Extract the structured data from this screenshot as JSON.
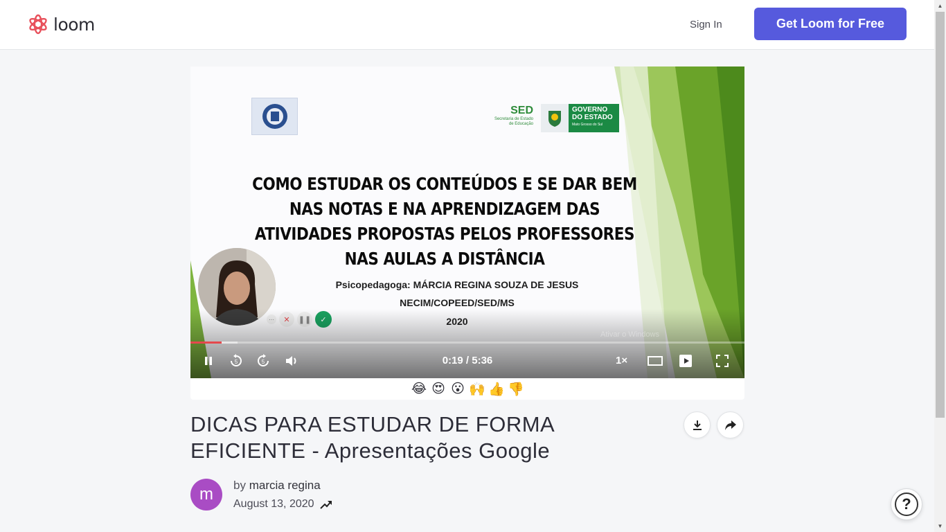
{
  "header": {
    "logo_text": "loom",
    "sign_in": "Sign In",
    "cta": "Get Loom for Free"
  },
  "slide": {
    "sed_label": "SED",
    "sed_sub": "Secretaria de Estado de Educação",
    "gov_label": "GOVERNO DO ESTADO",
    "gov_sub": "Mato Grosso do Sul",
    "title": "COMO ESTUDAR OS CONTEÚDOS E SE DAR BEM NAS NOTAS E NA APRENDIZAGEM DAS ATIVIDADES PROPOSTAS PELOS PROFESSORES NAS AULAS A DISTÂNCIA",
    "presenter": "Psicopedagoga: MÁRCIA REGINA SOUZA DE JESUS",
    "org": "NECIM/COPEED/SED/MS",
    "year": "2020",
    "watermark": "Ativar o Windows"
  },
  "player": {
    "time": "0:19 / 5:36",
    "speed": "1×",
    "progress": 0.056,
    "buffered": 0.085,
    "progress_color": "#e5484d"
  },
  "reactions": [
    "😂",
    "😍",
    "😮",
    "🙌",
    "👍",
    "👎"
  ],
  "video": {
    "title": "DICAS PARA ESTUDAR DE FORMA EFICIENTE - Apresentações Google",
    "by": "by",
    "owner": "marcia regina",
    "owner_initial": "m",
    "date": "August 13, 2020"
  },
  "help": {
    "label": "?"
  },
  "colors": {
    "accent": "#565add",
    "avatar": "#a94cc4",
    "green": "#1b8a44"
  }
}
